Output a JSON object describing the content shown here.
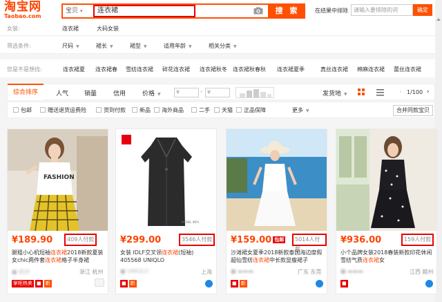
{
  "header": {
    "logo_cn": "淘宝网",
    "logo_en": "Taobao.com",
    "search_type": "宝贝",
    "search_value": "连衣裙",
    "search_button": "搜 索",
    "within_label": "在结果中排除",
    "within_placeholder": "请输入要排除的词",
    "within_button": "确定"
  },
  "category_row": {
    "label": "女装:",
    "items": [
      "连衣裙",
      "大码女装"
    ]
  },
  "filter_row": {
    "label": "筛选条件:",
    "items": [
      "尺码",
      "裙长",
      "裙型",
      "适用年龄",
      "相关分类"
    ]
  },
  "related_row": {
    "label": "您是不是想找:",
    "items": [
      "连衣裙夏",
      "连衣裙春",
      "雪纺连衣裙",
      "碎花连衣裙",
      "连衣裙秋冬",
      "连衣裙秋春秋",
      "连衣裙夏季",
      "真丝连衣裙",
      "棉麻连衣裙",
      "蕾丝连衣裙"
    ]
  },
  "sort_bar": {
    "items": [
      "综合排序",
      "人气",
      "销量",
      "信用",
      "价格"
    ],
    "price_from": "¥",
    "price_to": "¥",
    "ship_from": "发货地",
    "page": "1/100"
  },
  "options": [
    "包邮",
    "赠送退货运费险",
    "货到付款",
    "新品",
    "海外商品",
    "二手",
    "天猫",
    "正品保障"
  ],
  "options_more": "更多",
  "merge_button": "合并同款宝贝",
  "products": [
    {
      "price": "¥189.90",
      "paid": "409人付款",
      "title_pre": "腿粗小心机短袖",
      "title_hl": "连衣裙",
      "title_post": "2018新款夏装女chic两件套",
      "title_hl2": "连衣裙",
      "title_post2": "格子半身裙",
      "shop": "杭州",
      "location": "浙江 杭州",
      "badge": "掌柜热卖"
    },
    {
      "price": "¥299.00",
      "paid": "3546人付款",
      "title_pre": "女装 IDLF交叉领",
      "title_hl": "连衣裙",
      "title_post": "(短袖) 405568 UNIQLO",
      "title_hl2": "",
      "title_post2": "",
      "shop": "UNIQLO",
      "location": "上海",
      "badge": ""
    },
    {
      "price": "¥159.00",
      "paid": "5014人付款",
      "tag": "包邮",
      "title_pre": "沙滩裙女夏季2018新款泰国海边度假超仙雪纺",
      "title_hl": "连衣裙",
      "title_post": "中长款显瘦裙子",
      "title_hl2": "",
      "title_post2": "",
      "shop": "",
      "location": "广东 东莞",
      "badge": ""
    },
    {
      "price": "¥936.00",
      "paid": "159人付款",
      "title_pre": "小个品牌女装2018春装新款印花休闲雪纺气质",
      "title_hl": "连衣裙",
      "title_post": "女",
      "title_hl2": "",
      "title_post2": "",
      "shop": "",
      "location": "江西 赣州",
      "badge": ""
    }
  ],
  "colors": {
    "accent": "#ff5000",
    "price": "#ff4400",
    "highlight_box": "#e60000"
  }
}
